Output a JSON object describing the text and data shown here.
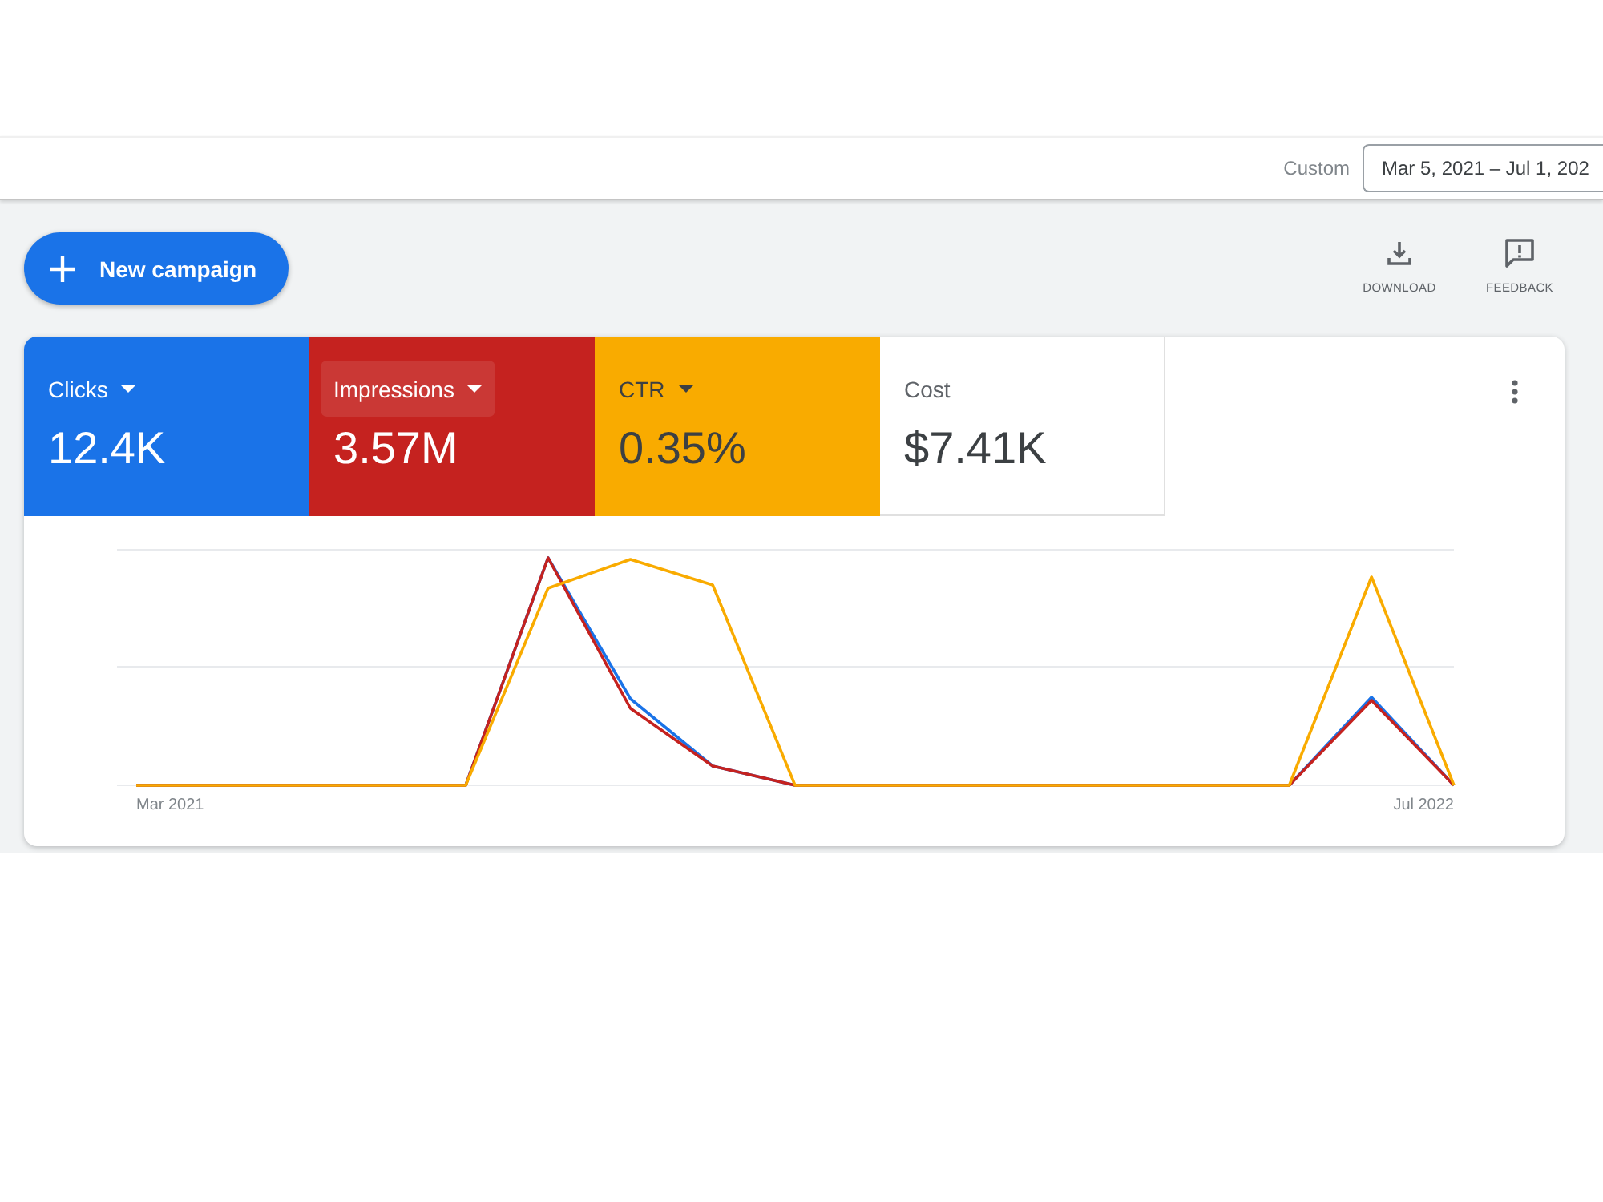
{
  "header": {
    "range_label": "Custom",
    "date_range": "Mar 5, 2021 – Jul 1, 202"
  },
  "toolbar": {
    "new_campaign": "New campaign",
    "actions": [
      {
        "kind": "download",
        "label": "DOWNLOAD"
      },
      {
        "kind": "feedback",
        "label": "FEEDBACK"
      }
    ]
  },
  "metrics": [
    {
      "label": "Clicks",
      "value": "12.4K",
      "selected": true,
      "hovered": false,
      "color": "#1a73e8"
    },
    {
      "label": "Impressions",
      "value": "3.57M",
      "selected": true,
      "hovered": true,
      "color": "#c5221f"
    },
    {
      "label": "CTR",
      "value": "0.35%",
      "selected": true,
      "hovered": false,
      "color": "#f9ab00"
    },
    {
      "label": "Cost",
      "value": "$7.41K",
      "selected": false,
      "hovered": false
    }
  ],
  "chart": {
    "x_labels": [
      "Mar 2021",
      "Jul 2022"
    ]
  }
}
